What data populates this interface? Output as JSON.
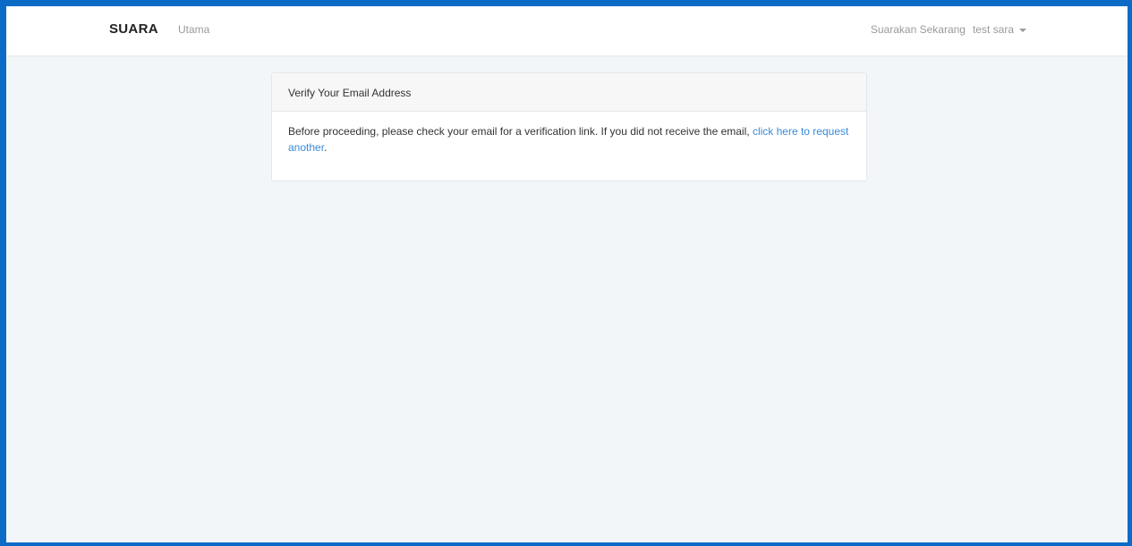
{
  "navbar": {
    "brand": "SUARA",
    "home_link": "Utama",
    "cta_link": "Suarakan Sekarang",
    "user_name": "test sara"
  },
  "card": {
    "title": "Verify Your Email Address",
    "body_text": "Before proceeding, please check your email for a verification link. If you did not receive the email, ",
    "link_text": "click here to request another",
    "trailing": "."
  },
  "colors": {
    "frame_border": "#0d6bc8",
    "background": "#f3f6f9",
    "link": "#3a8bd8"
  },
  "icons": {
    "user_menu": "caret-down-icon"
  }
}
